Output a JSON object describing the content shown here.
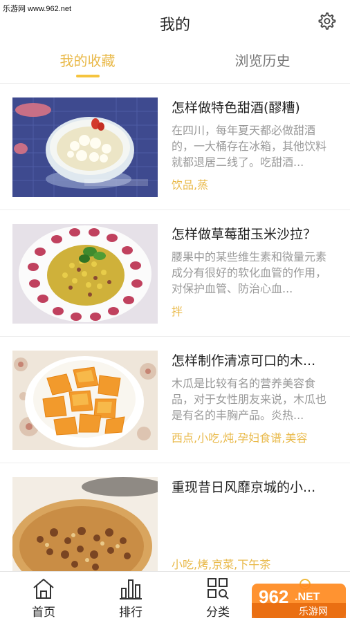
{
  "watermark_top": "乐游网 www.962.net",
  "header": {
    "title": "我的"
  },
  "tabs": [
    {
      "label": "我的收藏",
      "active": true
    },
    {
      "label": "浏览历史",
      "active": false
    }
  ],
  "items": [
    {
      "title": "怎样做特色甜酒(醪糟)",
      "desc": "在四川，每年夏天都必做甜酒的，一大桶存在冰箱，其他饮料就都退居二线了。吃甜酒...",
      "tags": "饮品,蒸",
      "image": "rice-wine-bowl-image"
    },
    {
      "title": "怎样做草莓甜玉米沙拉？",
      "desc": "腰果中的某些维生素和微量元素成分有很好的软化血管的作用，对保护血管、防治心血...",
      "tags": "拌",
      "image": "strawberry-corn-salad-image"
    },
    {
      "title": "怎样制作清凉可口的木...",
      "desc": "木瓜是比较有名的营养美容食品，对于女性朋友来说，木瓜也是有名的丰胸产品。炎热...",
      "tags": "西点,小吃,炖,孕妇食谱,美容",
      "image": "papaya-bowl-image"
    },
    {
      "title": "重现昔日风靡京城的小...",
      "desc": "",
      "tags": "小吃,烤,京菜,下午茶",
      "image": "baked-pastry-image"
    }
  ],
  "bottom_nav": [
    {
      "label": "首页",
      "icon": "home-icon"
    },
    {
      "label": "排行",
      "icon": "bar-chart-icon"
    },
    {
      "label": "分类",
      "icon": "category-grid-icon"
    },
    {
      "label": "",
      "icon": "profile-icon"
    }
  ],
  "watermark_badge": {
    "number": "962",
    "suffix": ".NET",
    "text": "乐游网"
  },
  "colors": {
    "accent": "#e9b949",
    "text": "#222222",
    "muted": "#999999"
  }
}
